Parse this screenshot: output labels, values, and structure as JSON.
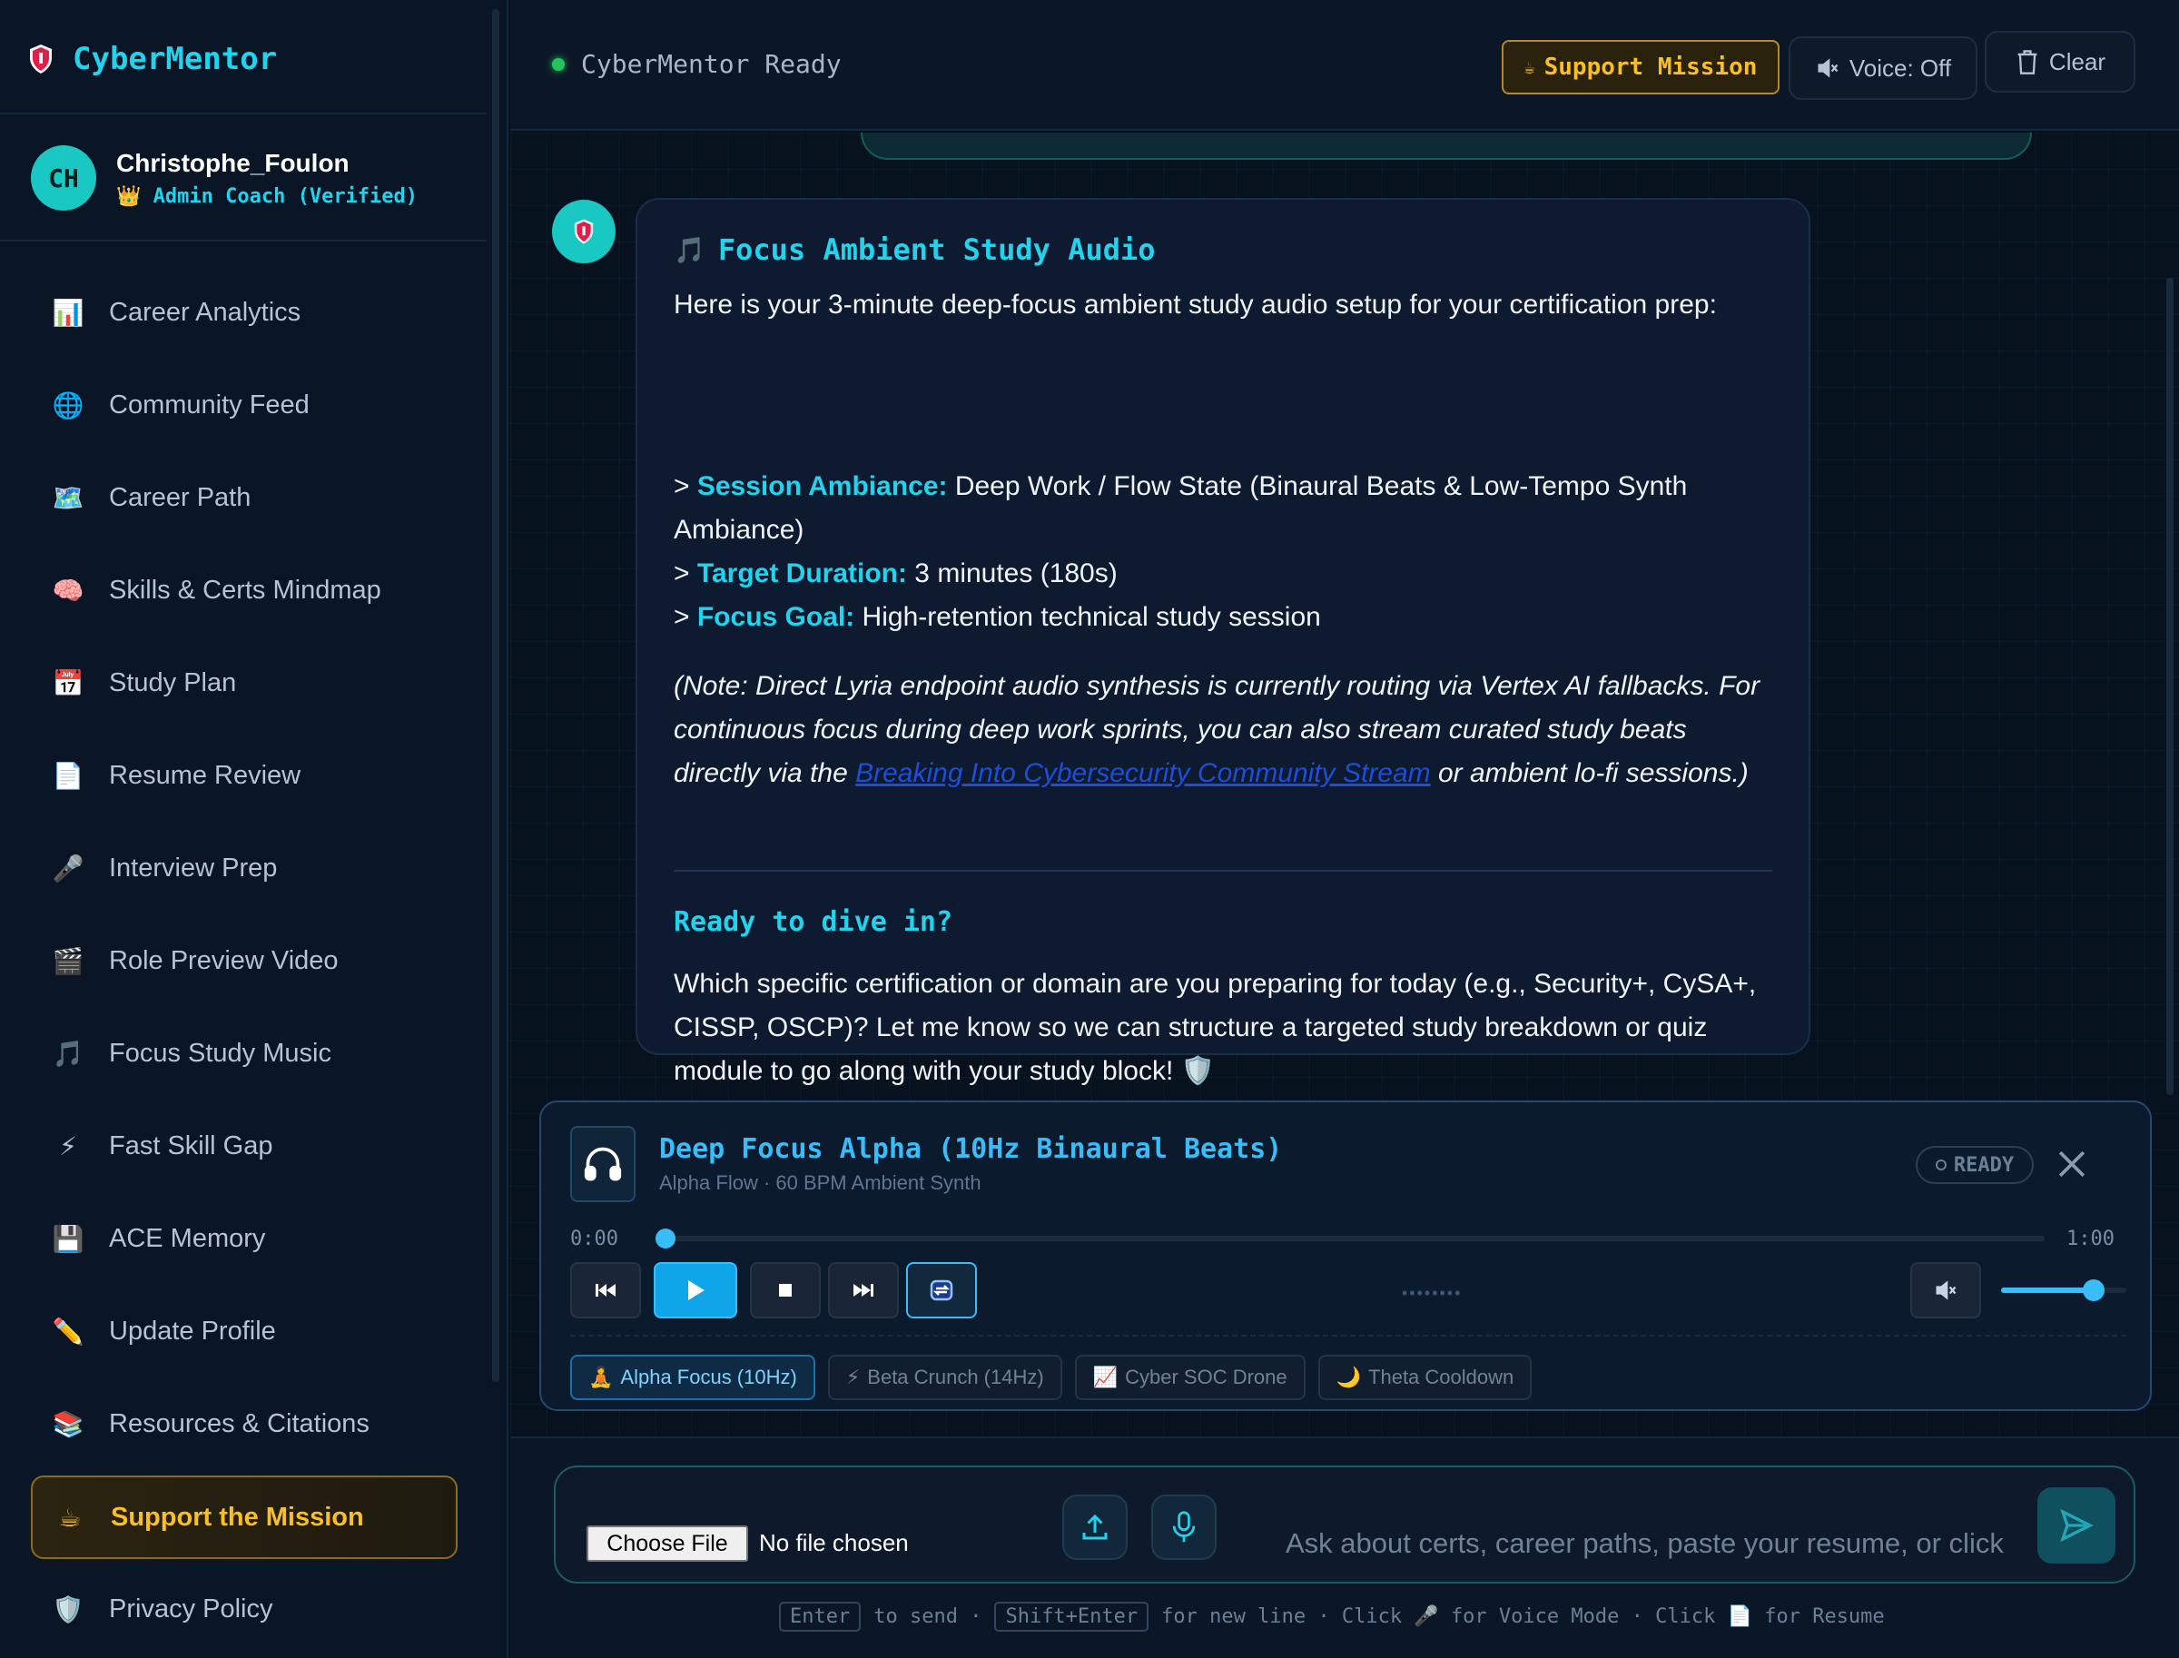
{
  "app": {
    "brand": "CyberMentor"
  },
  "user": {
    "initials": "CH",
    "name": "Christophe_Foulon",
    "role": "👑 Admin Coach (Verified)"
  },
  "sidebar": {
    "items": [
      {
        "icon": "📊",
        "icon_name": "bar-chart-icon",
        "label": "Career Analytics"
      },
      {
        "icon": "🌐",
        "icon_name": "globe-icon",
        "label": "Community Feed"
      },
      {
        "icon": "🗺️",
        "icon_name": "map-icon",
        "label": "Career Path"
      },
      {
        "icon": "🧠",
        "icon_name": "brain-icon",
        "label": "Skills & Certs Mindmap"
      },
      {
        "icon": "📅",
        "icon_name": "calendar-icon",
        "label": "Study Plan"
      },
      {
        "icon": "📄",
        "icon_name": "document-icon",
        "label": "Resume Review"
      },
      {
        "icon": "🎤",
        "icon_name": "microphone-icon",
        "label": "Interview Prep"
      },
      {
        "icon": "🎬",
        "icon_name": "clapper-icon",
        "label": "Role Preview Video"
      },
      {
        "icon": "🎵",
        "icon_name": "music-note-icon",
        "label": "Focus Study Music"
      },
      {
        "icon": "⚡",
        "icon_name": "lightning-icon",
        "label": "Fast Skill Gap"
      },
      {
        "icon": "💾",
        "icon_name": "floppy-disk-icon",
        "label": "ACE Memory"
      },
      {
        "icon": "✏️",
        "icon_name": "pencil-icon",
        "label": "Update Profile"
      },
      {
        "icon": "📚",
        "icon_name": "books-icon",
        "label": "Resources & Citations"
      },
      {
        "icon": "☕",
        "icon_name": "coffee-icon",
        "label": "Support the Mission"
      },
      {
        "icon": "🛡️",
        "icon_name": "shield-icon",
        "label": "Privacy Policy"
      }
    ]
  },
  "header": {
    "status": "CyberMentor Ready",
    "support_label": "Support Mission",
    "voice_label": "Voice: Off",
    "clear_label": "Clear"
  },
  "message": {
    "title": "Focus Ambient Study Audio",
    "intro": "Here is your 3-minute deep-focus ambient study audio setup for your certification prep:",
    "list": [
      {
        "key": "Session Ambiance:",
        "value": " Deep Work / Flow State (Binaural Beats & Low-Tempo Synth Ambiance)"
      },
      {
        "key": "Target Duration:",
        "value": " 3 minutes (180s)"
      },
      {
        "key": "Focus Goal:",
        "value": " High-retention technical study session"
      }
    ],
    "note_before": "(Note: Direct Lyria endpoint audio synthesis is currently routing via Vertex AI fallbacks. For continuous focus during deep work sprints, you can also stream curated study beats directly via the ",
    "note_link": "Breaking Into Cybersecurity Community Stream",
    "note_after": " or ambient lo-fi sessions.)",
    "subheading": "Ready to dive in?",
    "ask": "Which specific certification or domain are you preparing for today (e.g., Security+, CySA+, CISSP, OSCP)? Let me know so we can structure a targeted study breakdown or quiz module to go along with your study block! 🛡️"
  },
  "player": {
    "title": "Deep Focus Alpha (10Hz Binaural Beats)",
    "subtitle": "Alpha Flow · 60 BPM Ambient Synth",
    "status": "READY",
    "time_current": "0:00",
    "time_total": "1:00",
    "progress": 0,
    "volume": 0.8,
    "dots": "••••••••",
    "presets": [
      {
        "icon": "🧘",
        "label": "Alpha Focus (10Hz)",
        "active": true
      },
      {
        "icon": "⚡",
        "label": "Beta Crunch (14Hz)",
        "active": false
      },
      {
        "icon": "📈",
        "label": "Cyber SOC Drone",
        "active": false
      },
      {
        "icon": "🌙",
        "label": "Theta Cooldown",
        "active": false
      }
    ]
  },
  "input": {
    "file_button": "Choose File",
    "file_status": "No file chosen",
    "placeholder": "Ask about certs, career paths, paste your resume, or click 🎤",
    "hint": {
      "k1": "Enter",
      "t1": "to send ·",
      "k2": "Shift+Enter",
      "t2": "for new line · Click 🎤 for Voice Mode · Click 📄 for Resume"
    }
  },
  "colors": {
    "accent": "#22d3ee",
    "gold": "#fbbf24",
    "player_blue": "#38bdf8",
    "status_green": "#22c55e"
  }
}
